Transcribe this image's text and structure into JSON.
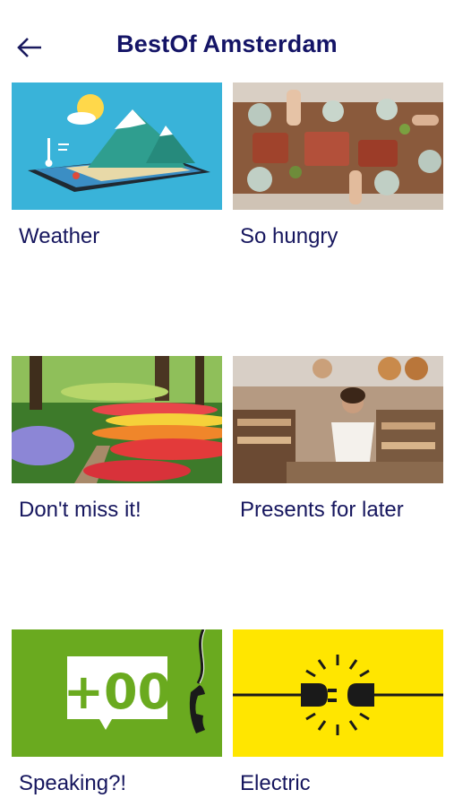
{
  "header": {
    "title": "BestOf Amsterdam",
    "back_icon": "arrow-left-icon"
  },
  "tiles": [
    {
      "label": "Weather",
      "image": "tablet-mountain-weather-illustration"
    },
    {
      "label": "So hungry",
      "image": "people-sharing-food-table-photo"
    },
    {
      "label": "Don't miss it!",
      "image": "tulip-garden-photo"
    },
    {
      "label": "Presents for later",
      "image": "woman-shopping-market-photo"
    },
    {
      "label": "Speaking?!",
      "image": "+00 phone-call-icon"
    },
    {
      "label": "Electric",
      "image": "plug-socket-icon"
    }
  ],
  "colors": {
    "title": "#141466",
    "speaking_bg": "#6aaa1f",
    "electric_bg": "#ffe600"
  }
}
